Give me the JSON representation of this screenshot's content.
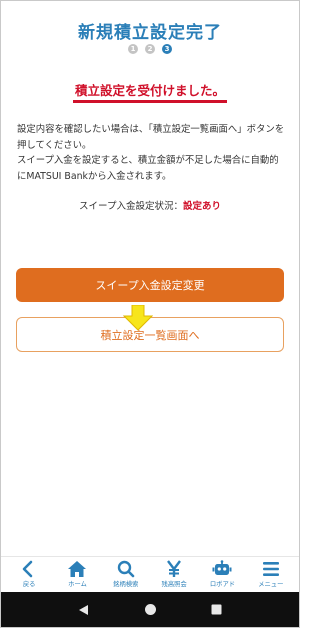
{
  "header": {
    "title": "新規積立設定完了",
    "steps": [
      "1",
      "2",
      "3"
    ]
  },
  "message": {
    "received": "積立設定を受付けました。",
    "description_1": "設定内容を確認したい場合は、「積立設定一覧画面へ」ボタンを押してください。",
    "description_2": "スイープ入金を設定すると、積立金額が不足した場合に自動的にMATSUI Bankから入金されます。"
  },
  "status": {
    "label": "スイープ入金設定状況：",
    "value": "設定あり"
  },
  "buttons": {
    "sweep": "スイープ入金設定変更",
    "list": "積立設定一覧画面へ"
  },
  "nav": {
    "items": [
      {
        "label": "戻る",
        "icon": "back-icon"
      },
      {
        "label": "ホーム",
        "icon": "home-icon"
      },
      {
        "label": "銘柄検索",
        "icon": "search-icon"
      },
      {
        "label": "残高照会",
        "icon": "yen-icon"
      },
      {
        "label": "ロボアド",
        "icon": "robot-icon"
      },
      {
        "label": "メニュー",
        "icon": "menu-icon"
      }
    ]
  },
  "colors": {
    "accent_blue": "#2b7fb8",
    "alert_red": "#d0102a",
    "button_orange": "#df6d1f",
    "arrow_yellow": "#f7e51c"
  }
}
